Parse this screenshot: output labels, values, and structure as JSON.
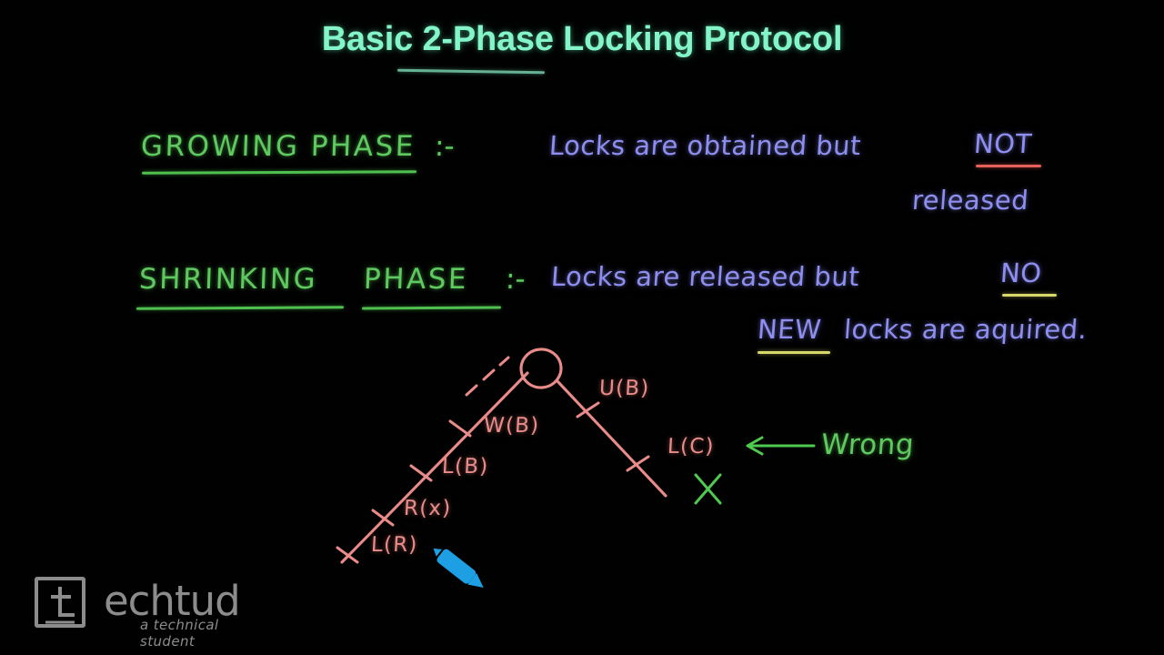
{
  "slide": {
    "title": "Basic 2-Phase Locking Protocol",
    "background_color": "#000000"
  },
  "colors": {
    "title_mint": "#84f5c8",
    "marker_green": "#5ec95e",
    "marker_blue": "#8e8ef0",
    "marker_salmon": "#e98b89",
    "underline_red": "#e8605a",
    "underline_yellow": "#d8d86a",
    "logo_gray": "#8c8c8c",
    "pen_cursor_blue": "#1e9fe3"
  },
  "notes": {
    "growing": {
      "heading": "GROWING PHASE",
      "colon": ":-",
      "line1": "Locks are obtained but",
      "emphasis1": "NOT",
      "line2": "released"
    },
    "shrinking": {
      "heading_word1": "SHRINKING",
      "heading_word2": "PHASE",
      "colon": ":-",
      "line1": "Locks are released but",
      "emphasis1": "NO",
      "emphasis2": "NEW",
      "line2_rest": "locks are aquired."
    }
  },
  "diagram": {
    "growing_labels": [
      {
        "text": "L(R)"
      },
      {
        "text": "R(x)"
      },
      {
        "text": "L(B)"
      },
      {
        "text": "W(B)"
      }
    ],
    "shrinking_labels": [
      {
        "text": "U(B)"
      },
      {
        "text": "L(C)"
      }
    ],
    "annotation": "Wrong",
    "arrow": "⟵",
    "cross_mark": "✕"
  },
  "logo": {
    "wordmark": "echtud",
    "tagline": "a technical student"
  }
}
